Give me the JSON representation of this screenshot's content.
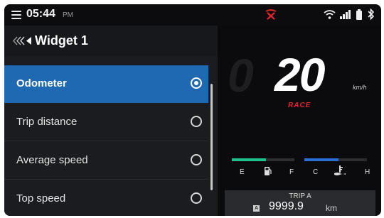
{
  "status_bar": {
    "time": "05:44",
    "ampm": "PM",
    "icons": [
      "menu-icon",
      "connection-lost-icon",
      "wifi-icon",
      "signal-icon",
      "battery-icon",
      "bluetooth-icon"
    ],
    "accent_color": "#e0262c"
  },
  "widget_panel": {
    "title": "Widget 1",
    "back_icon": "back-chevrons-icon",
    "items": [
      {
        "label": "Odometer",
        "selected": true
      },
      {
        "label": "Trip distance",
        "selected": false
      },
      {
        "label": "Average speed",
        "selected": false
      },
      {
        "label": "Top speed",
        "selected": false
      }
    ],
    "selected_color": "#1f69b3"
  },
  "dashboard": {
    "speed": "20",
    "speed_unit": "km/h",
    "mode": "RACE",
    "fuel": {
      "empty_label": "E",
      "full_label": "F",
      "icon": "fuel-pump-icon",
      "color": "#1ec28a",
      "level": 0.55
    },
    "temperature": {
      "cold_label": "C",
      "hot_label": "H",
      "icon": "coolant-temperature-icon",
      "color": "#2a6fd6",
      "level": 0.55
    },
    "trip": {
      "title": "TRIP A",
      "icon_label": "A",
      "value": "9999.9",
      "unit": "km"
    }
  }
}
